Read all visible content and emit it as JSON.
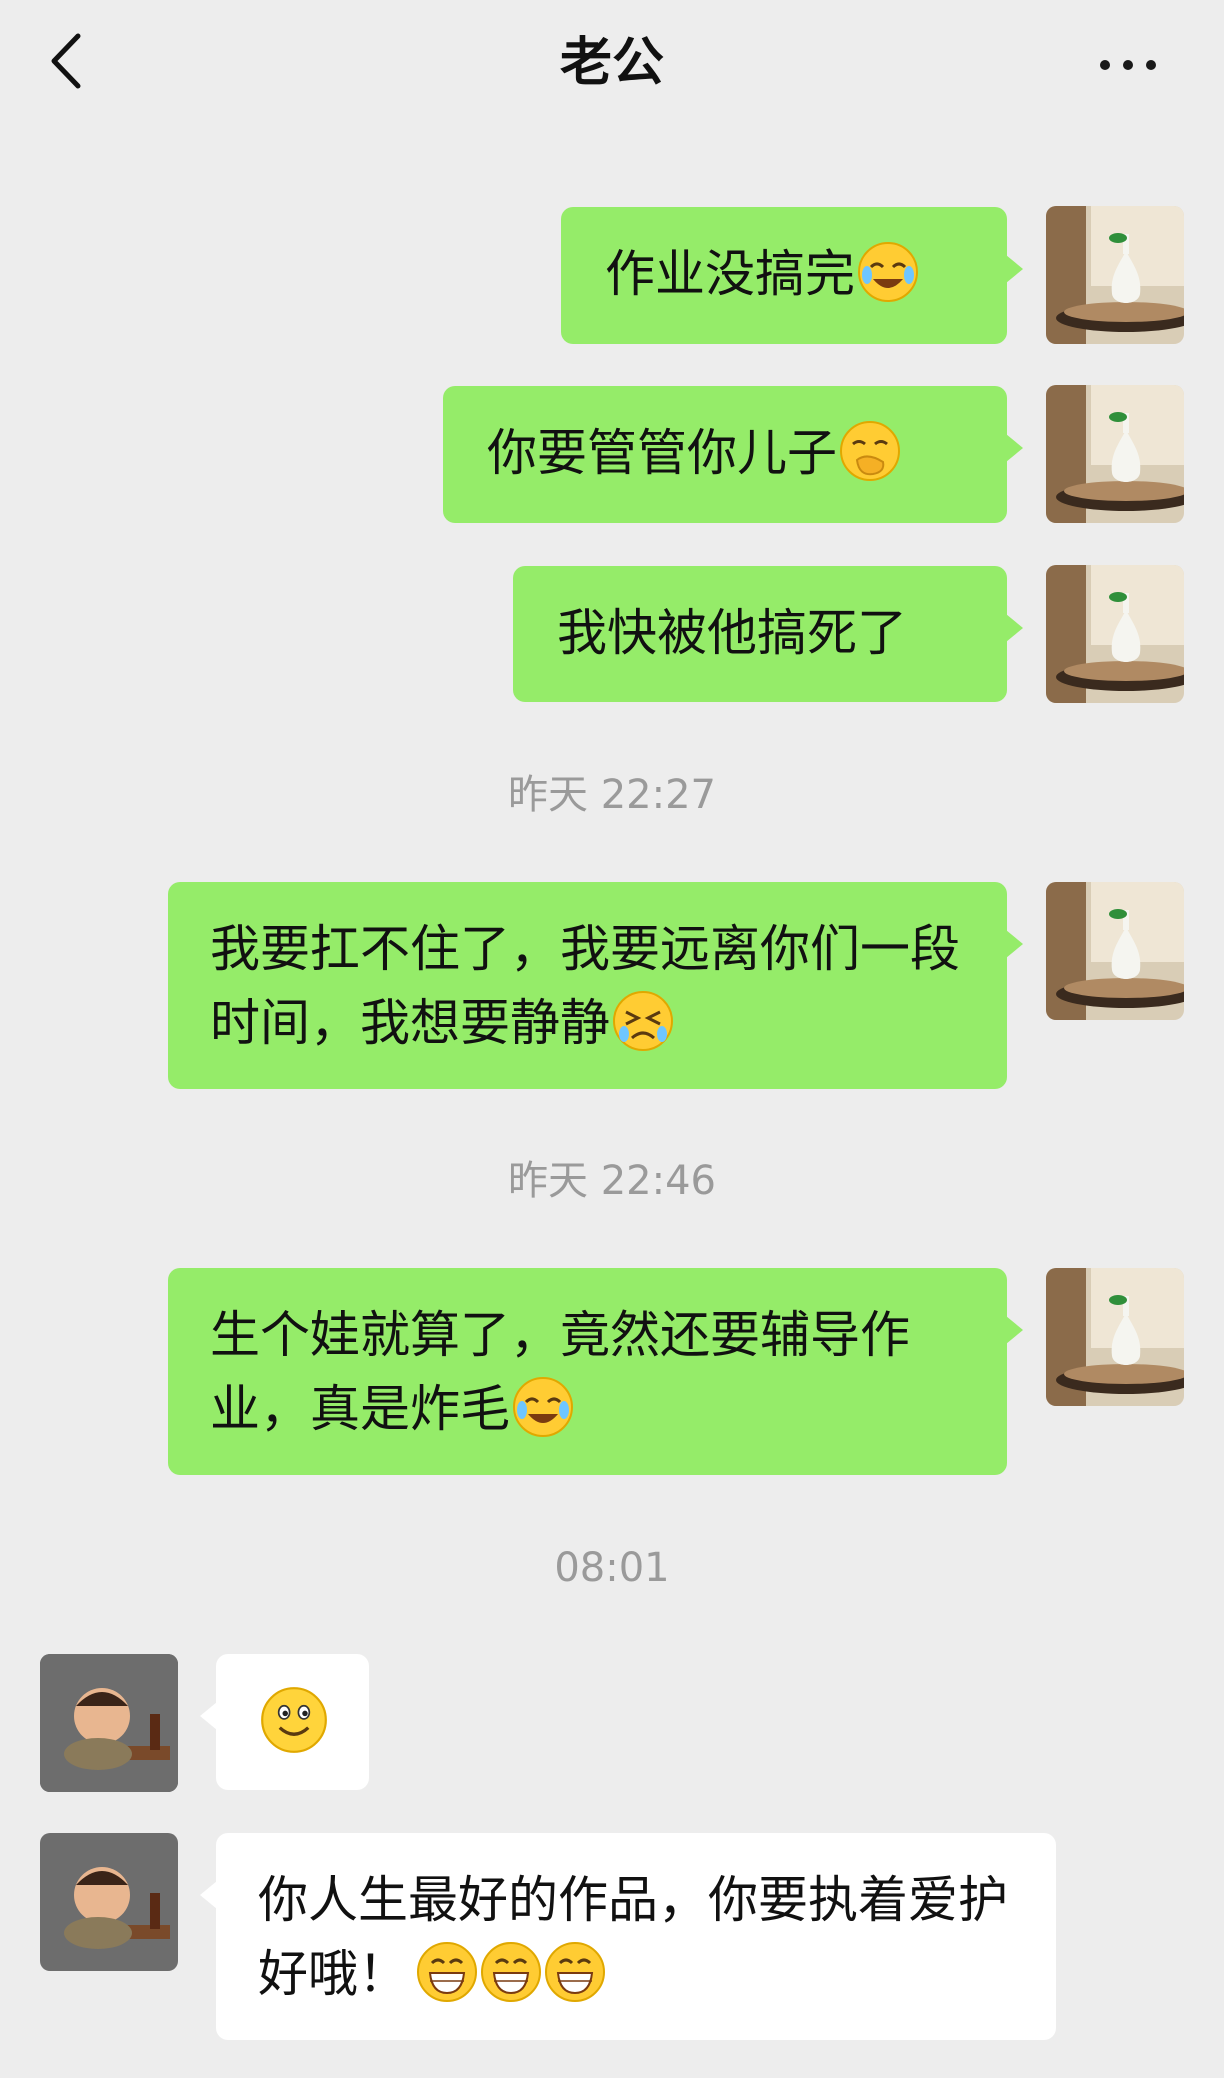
{
  "header": {
    "title": "老公",
    "back_icon": "chevron-left-icon",
    "more_icon": "more-dots-icon"
  },
  "colors": {
    "background": "#EDEDED",
    "bubble_out": "#95EC69",
    "bubble_in": "#FFFFFF",
    "timestamp": "#9A9A9A"
  },
  "messages": [
    {
      "from": "me",
      "text": "作业没搞完",
      "emojis": [
        "cry-laugh-emoji"
      ]
    },
    {
      "from": "me",
      "text": "你要管管你儿子",
      "emojis": [
        "hand-over-mouth-emoji"
      ]
    },
    {
      "from": "me",
      "text": "我快被他搞死了",
      "emojis": []
    },
    {
      "timestamp": "昨天 22:27"
    },
    {
      "from": "me",
      "text": "我要扛不住了，我要远离你们一段时间，我想要静静",
      "emojis": [
        "crying-emoji"
      ]
    },
    {
      "timestamp": "昨天 22:46"
    },
    {
      "from": "me",
      "text": "生个娃就算了，竟然还要辅导作业，真是炸毛",
      "emojis": [
        "cry-laugh-emoji"
      ]
    },
    {
      "timestamp": "08:01"
    },
    {
      "from": "other",
      "text": "",
      "emojis": [
        "smile-emoji"
      ]
    },
    {
      "from": "other",
      "text": "你人生最好的作品，你要执着爱护好哦！",
      "emojis": [
        "grin-emoji",
        "grin-emoji",
        "grin-emoji"
      ]
    }
  ]
}
